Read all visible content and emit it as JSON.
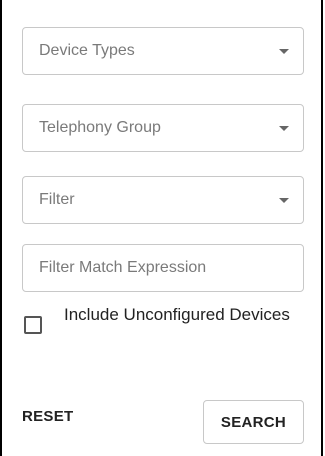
{
  "filters": {
    "device_types": {
      "label": "Device Types"
    },
    "telephony_group": {
      "label": "Telephony Group"
    },
    "filter": {
      "label": "Filter"
    },
    "match_expression": {
      "placeholder": "Filter Match Expression"
    }
  },
  "include_unconfigured": {
    "label": "Include Unconfigured Devices",
    "checked": false
  },
  "actions": {
    "reset_label": "RESET",
    "search_label": "SEARCH"
  }
}
